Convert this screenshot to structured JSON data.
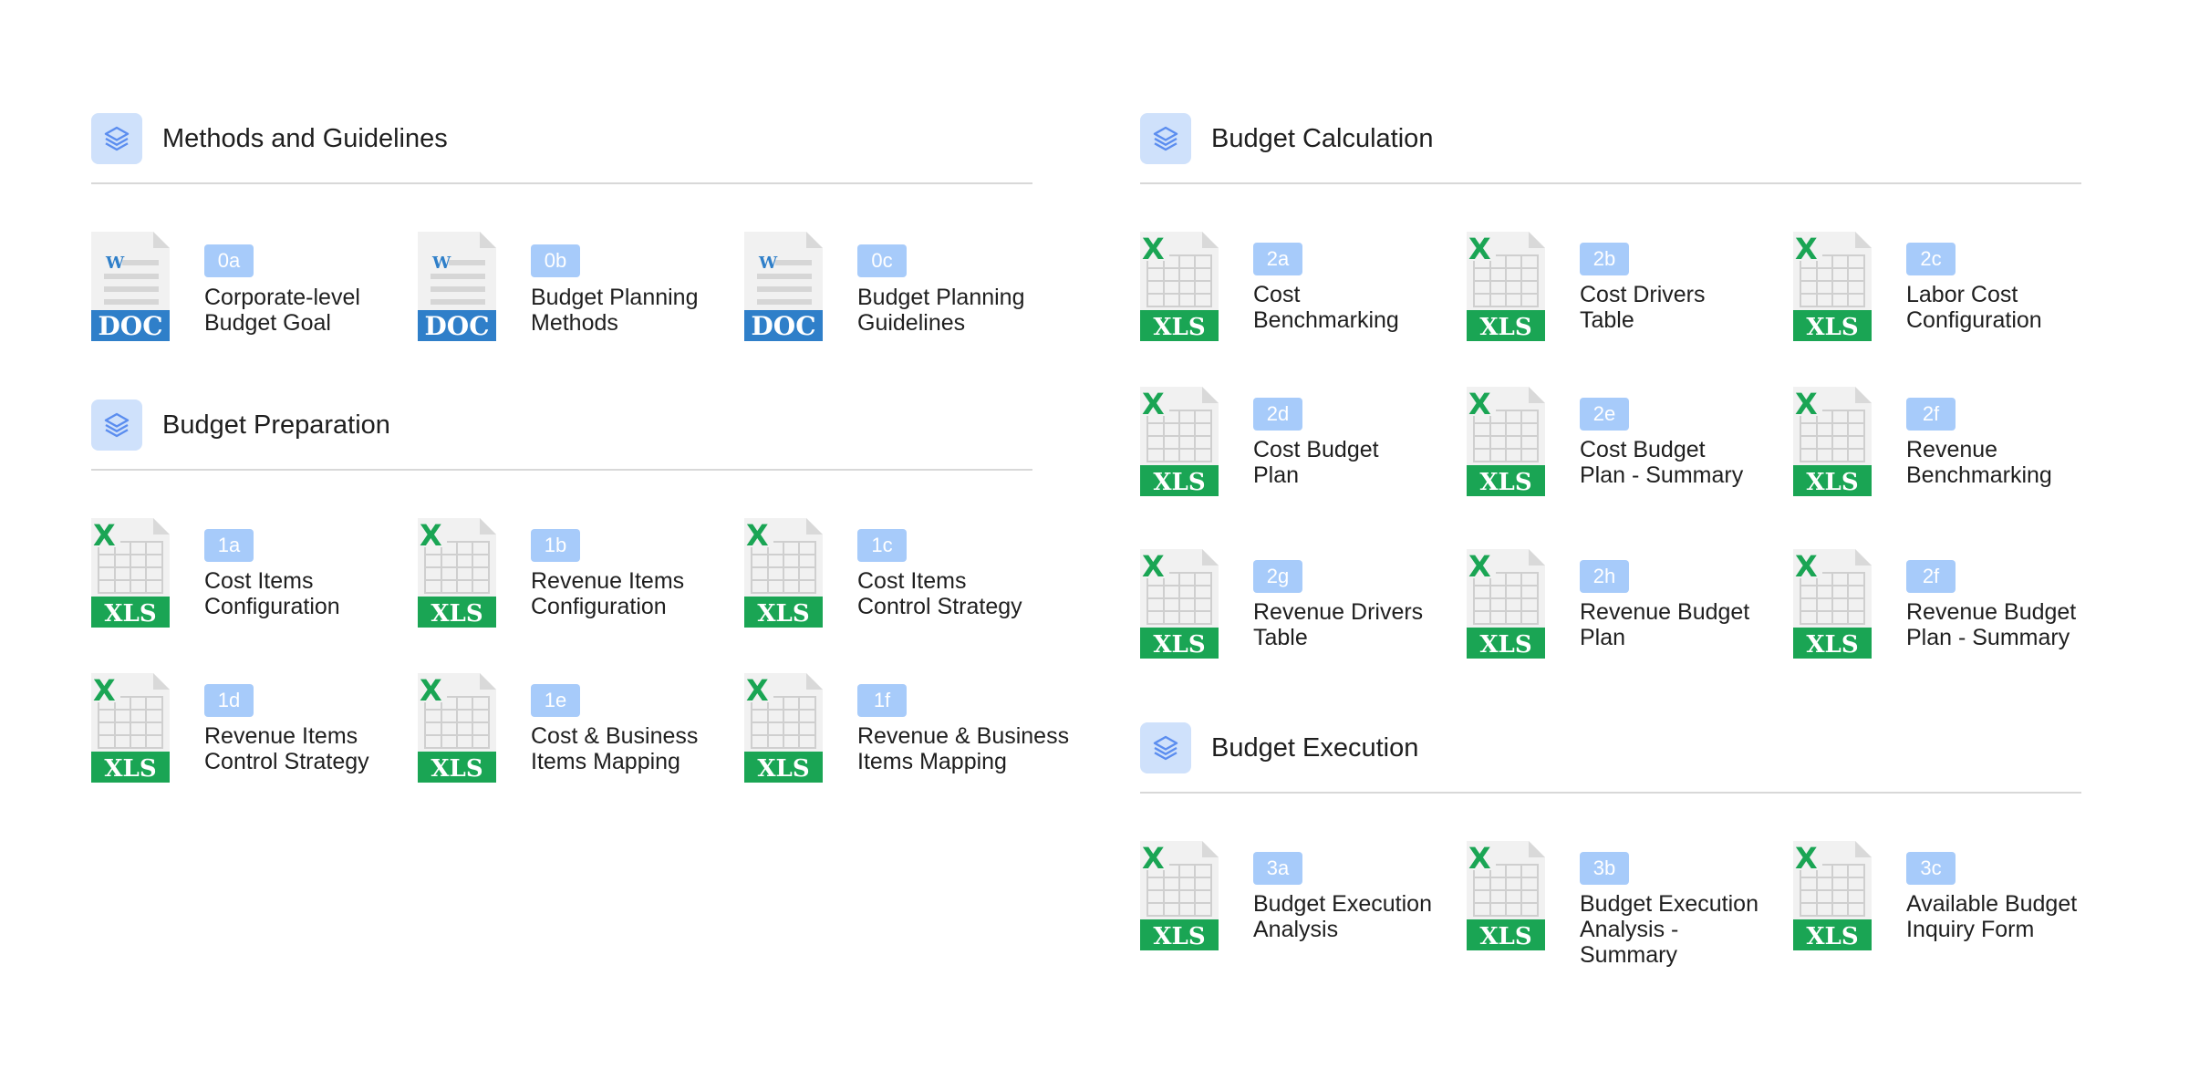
{
  "sections": [
    {
      "title": "Methods and Guidelines",
      "items": [
        {
          "code": "0a",
          "label": "Corporate-level\nBudget Goal",
          "type": "DOC"
        },
        {
          "code": "0b",
          "label": "Budget Planning\nMethods",
          "type": "DOC"
        },
        {
          "code": "0c",
          "label": "Budget Planning\nGuidelines",
          "type": "DOC"
        }
      ]
    },
    {
      "title": "Budget Preparation",
      "items": [
        {
          "code": "1a",
          "label": "Cost Items\nConfiguration",
          "type": "XLS"
        },
        {
          "code": "1b",
          "label": "Revenue Items\nConfiguration",
          "type": "XLS"
        },
        {
          "code": "1c",
          "label": "Cost Items\nControl Strategy",
          "type": "XLS"
        },
        {
          "code": "1d",
          "label": "Revenue Items\nControl Strategy",
          "type": "XLS"
        },
        {
          "code": "1e",
          "label": "Cost & Business\nItems Mapping",
          "type": "XLS"
        },
        {
          "code": "1f",
          "label": "Revenue & Business\nItems Mapping",
          "type": "XLS"
        }
      ]
    },
    {
      "title": "Budget Calculation",
      "items": [
        {
          "code": "2a",
          "label": "Cost\nBenchmarking",
          "type": "XLS"
        },
        {
          "code": "2b",
          "label": "Cost Drivers\nTable",
          "type": "XLS"
        },
        {
          "code": "2c",
          "label": "Labor Cost\nConfiguration",
          "type": "XLS"
        },
        {
          "code": "2d",
          "label": "Cost Budget\nPlan",
          "type": "XLS"
        },
        {
          "code": "2e",
          "label": "Cost Budget\nPlan - Summary",
          "type": "XLS"
        },
        {
          "code": "2f",
          "label": "Revenue\nBenchmarking",
          "type": "XLS"
        },
        {
          "code": "2g",
          "label": "Revenue Drivers\nTable",
          "type": "XLS"
        },
        {
          "code": "2h",
          "label": "Revenue Budget\nPlan",
          "type": "XLS"
        },
        {
          "code": "2f",
          "label": "Revenue Budget\nPlan - Summary",
          "type": "XLS"
        }
      ]
    },
    {
      "title": "Budget Execution",
      "items": [
        {
          "code": "3a",
          "label": "Budget Execution\nAnalysis",
          "type": "XLS"
        },
        {
          "code": "3b",
          "label": "Budget Execution\nAnalysis -\nSummary",
          "type": "XLS"
        },
        {
          "code": "3c",
          "label": "Available Budget\nInquiry Form",
          "type": "XLS"
        }
      ]
    }
  ],
  "colors": {
    "accent": "#5b8def",
    "badge": "#a7cbfa",
    "section_icon_bg": "#cfe1fb",
    "xls_green": "#1aa554",
    "doc_blue": "#2f7fc9",
    "rule": "#d8d8d8"
  },
  "icons": {
    "section": "layers-icon",
    "doc": "word-doc-file-icon",
    "xls": "excel-xls-file-icon"
  }
}
